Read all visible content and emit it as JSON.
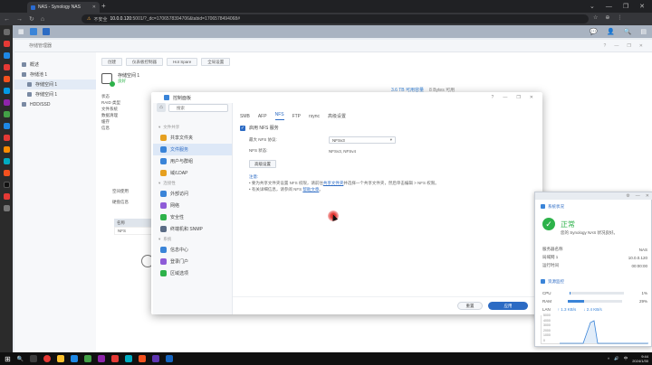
{
  "browser": {
    "tab_title": "NAS - Synology NAS",
    "tab_close": "✕",
    "new_tab": "+",
    "window_controls": [
      "⌄",
      "—",
      "❐",
      "✕"
    ],
    "nav": [
      "←",
      "→",
      "↻",
      "⌂"
    ],
    "security_warning": "不安全",
    "url_host": "10.0.0.120",
    "url_path": ":5001/?_dc=1706578394706&tabid=1706578494068#",
    "omni_icons": [
      "☆",
      "⊕",
      "⋮"
    ]
  },
  "dsm": {
    "topbar_icons": [
      "▦",
      "⧉"
    ],
    "topbar_right": [
      "💬",
      "👤",
      "🔍",
      "▤"
    ]
  },
  "storage_manager": {
    "title": "存储管理器",
    "controls": [
      "?",
      "—",
      "❐",
      "✕"
    ],
    "nav": [
      {
        "label": "概述",
        "selected": false
      },
      {
        "label": "存储池 1",
        "selected": false
      },
      {
        "label": "存储空间 1",
        "selected": true
      },
      {
        "label": "存储空间 1",
        "selected": false
      },
      {
        "label": "HDD/SSD",
        "selected": false
      }
    ],
    "buttons": [
      "创建",
      "仪表板控制器",
      "Hot Spare",
      "全局设置"
    ],
    "volume": {
      "name": "存储空间 1",
      "status": "良好",
      "details": [
        "状态",
        "RAID 类型",
        "文件系统",
        "数据清理",
        "缓存",
        "信息"
      ],
      "section": "空间使用",
      "section2": "硬盘信息"
    },
    "capacity": "3.6 TB 可用容量",
    "capacity_used": "8 Bytes 可用",
    "table_header": "名称",
    "table_row": "NFS"
  },
  "control_panel": {
    "title": "控制面板",
    "controls": [
      "?",
      "—",
      "❐",
      "✕"
    ],
    "search_placeholder": "搜索",
    "home_icon": "⌂",
    "sections": [
      {
        "label": "文件共享",
        "items": [
          {
            "label": "共享文件夹",
            "color": "#e6a020",
            "selected": false
          },
          {
            "label": "文件服务",
            "color": "#3a84d8",
            "selected": true
          },
          {
            "label": "用户与群组",
            "color": "#3a84d8",
            "selected": false
          },
          {
            "label": "域/LDAP",
            "color": "#e6a020",
            "selected": false
          }
        ]
      },
      {
        "label": "连接性",
        "items": [
          {
            "label": "外部访问",
            "color": "#3a84d8",
            "selected": false
          },
          {
            "label": "网络",
            "color": "#8e5bd8",
            "selected": false
          },
          {
            "label": "安全性",
            "color": "#2db24a",
            "selected": false
          },
          {
            "label": "终端机和 SNMP",
            "color": "#5a6b85",
            "selected": false
          }
        ]
      },
      {
        "label": "系统",
        "items": [
          {
            "label": "信息中心",
            "color": "#3a84d8",
            "selected": false
          },
          {
            "label": "登录门户",
            "color": "#8e5bd8",
            "selected": false
          },
          {
            "label": "区域选项",
            "color": "#2db24a",
            "selected": false
          }
        ]
      }
    ],
    "tabs": [
      {
        "label": "SMB",
        "active": false
      },
      {
        "label": "AFP",
        "active": false
      },
      {
        "label": "NFS",
        "active": true
      },
      {
        "label": "FTP",
        "active": false
      },
      {
        "label": "rsync",
        "active": false
      },
      {
        "label": "高级设置",
        "active": false
      }
    ],
    "nfs": {
      "enable_label": "启用 NFS 服务",
      "max_protocol_label": "最大 NFS 协议:",
      "max_protocol_value": "NFSv3",
      "status_label": "NFS 状态:",
      "status_value": "NFSv3, NFSv4",
      "advanced_button": "高级设置",
      "note_title": "注意:",
      "note1_a": "要为共享文件夹设置 NFS 权限，请前往",
      "note1_link": "共享文件夹",
      "note1_b": "并选择一个共享文件夹，然后单击编辑 > NFS 权限。",
      "note2_a": "有关详细信息，请参阅 NFS",
      "note2_link": "帮助文章",
      "note2_b": "。"
    },
    "reset_button": "重置",
    "apply_button": "应用"
  },
  "resource_monitor": {
    "head_icons": [
      "⚙",
      "—",
      "✕"
    ],
    "system_health_label": "系统状况",
    "health_status": "正常",
    "health_desc": "您的 Synology NAS 状况良好。",
    "info": [
      {
        "k": "服务器名称",
        "v": "NAS"
      },
      {
        "k": "局域网 1",
        "v": "10.0.0.120"
      },
      {
        "k": "运行时间",
        "v": "00:00:00"
      }
    ],
    "resource_label": "资源监控",
    "cpu_label": "CPU",
    "cpu_value": "1%",
    "cpu": 0.01,
    "ram_label": "RAM",
    "ram_value": "29%",
    "ram": 0.29,
    "lan_label": "LAN",
    "lan_up": "↑ 1.3 KB/s",
    "lan_down": "↓ 2.4 KB/s",
    "chart_ticks": [
      "5000",
      "4000",
      "3000",
      "2000",
      "1000",
      "0"
    ]
  },
  "taskbar": {
    "start_icon": "⊞",
    "search_icon": "🔍",
    "tray": [
      "^",
      "🔊",
      "中"
    ],
    "time": "9:44",
    "date": "2024/1/30"
  }
}
